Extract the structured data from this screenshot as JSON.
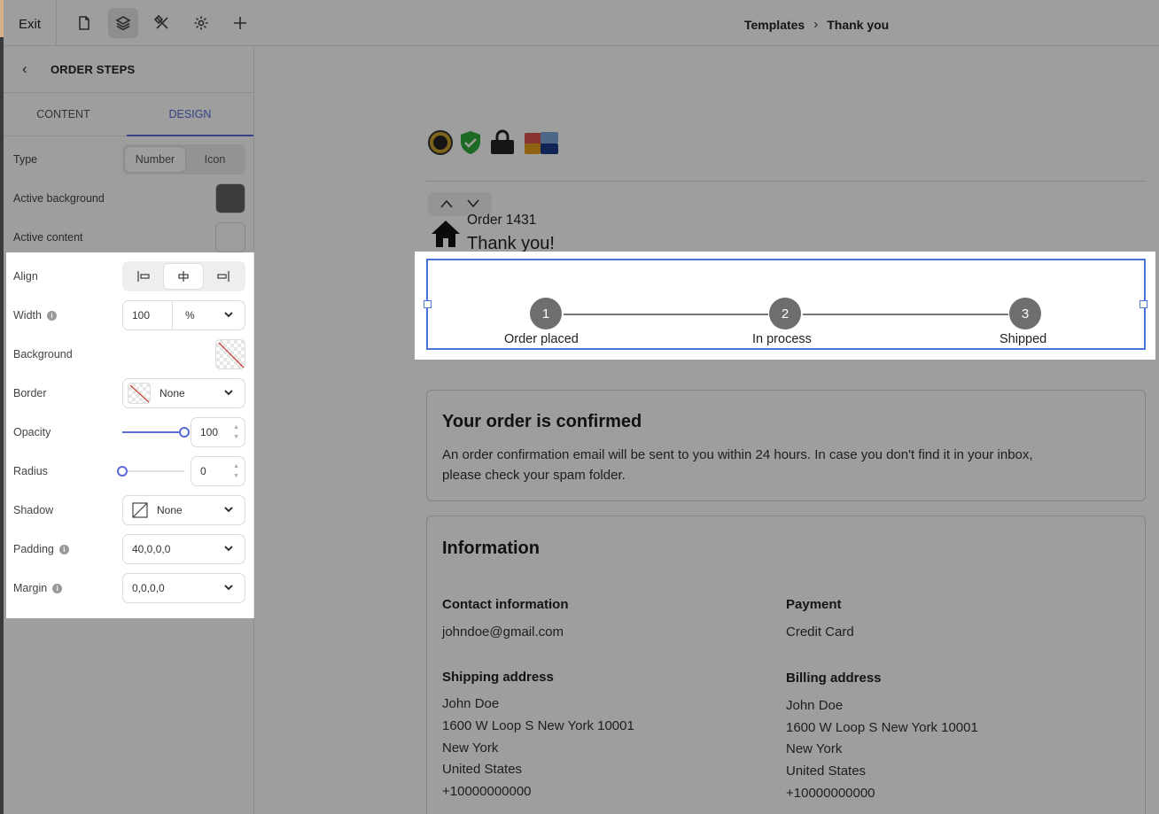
{
  "topbar": {
    "exit_label": "Exit",
    "breadcrumb": {
      "parent": "Templates",
      "current": "Thank you"
    }
  },
  "panel": {
    "title": "ORDER STEPS",
    "tabs": {
      "content": "CONTENT",
      "design": "DESIGN"
    },
    "type": {
      "label": "Type",
      "options": [
        "Number",
        "Icon"
      ],
      "selected": "Number"
    },
    "active_background": {
      "label": "Active background",
      "color": "#5f5f5f"
    },
    "active_content": {
      "label": "Active content",
      "color": "#ffffff"
    },
    "align": {
      "label": "Align",
      "selected": "center"
    },
    "width": {
      "label": "Width",
      "value": "100",
      "unit": "%"
    },
    "background": {
      "label": "Background"
    },
    "border": {
      "label": "Border",
      "value": "None"
    },
    "opacity": {
      "label": "Opacity",
      "value": "100",
      "percent": 100
    },
    "radius": {
      "label": "Radius",
      "value": "0",
      "percent": 0
    },
    "shadow": {
      "label": "Shadow",
      "value": "None"
    },
    "padding": {
      "label": "Padding",
      "value": "40,0,0,0"
    },
    "margin": {
      "label": "Margin",
      "value": "0,0,0,0"
    }
  },
  "page": {
    "order_number": "Order 1431",
    "thank_you": "Thank you!",
    "steps": [
      {
        "number": "1",
        "label": "Order placed"
      },
      {
        "number": "2",
        "label": "In process"
      },
      {
        "number": "3",
        "label": "Shipped"
      }
    ],
    "confirm": {
      "title": "Your order is confirmed",
      "line1": "An order confirmation email will be sent to you within 24 hours. In case you don't find it in your inbox,",
      "line2": "please check your spam folder."
    },
    "information": {
      "title": "Information",
      "contact": {
        "title": "Contact information",
        "email": "johndoe@gmail.com"
      },
      "payment": {
        "title": "Payment",
        "method": "Credit Card"
      },
      "shipping": {
        "title": "Shipping address",
        "name": "John Doe",
        "street": "1600 W Loop S New York 10001",
        "city": "New York",
        "country": "United States",
        "phone": "+10000000000"
      },
      "billing": {
        "title": "Billing address",
        "name": "John Doe",
        "street": "1600 W Loop S New York 10001",
        "city": "New York",
        "country": "United States",
        "phone": "+10000000000"
      }
    }
  },
  "colors": {
    "accent": "#5a6ad6",
    "selection": "#4a76d9",
    "step_circle": "#6e6e6e"
  }
}
